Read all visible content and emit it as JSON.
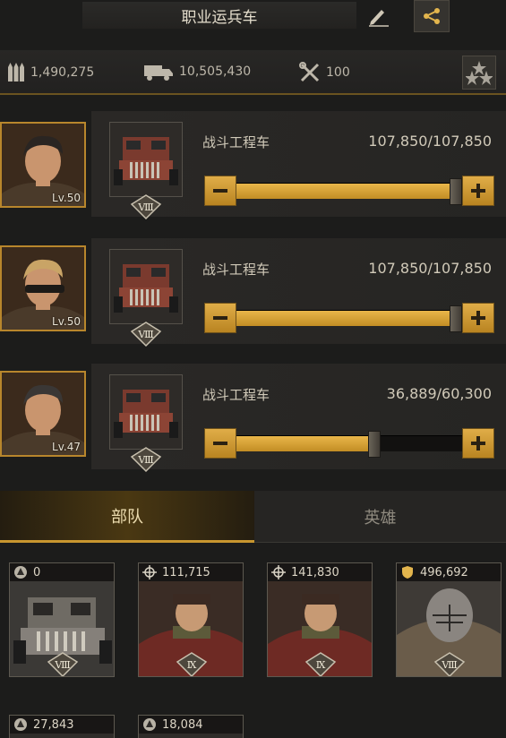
{
  "header": {
    "title": "职业运兵车",
    "edit_icon": "pencil-icon",
    "share_icon": "share-icon"
  },
  "stats": {
    "ammo": "1,490,275",
    "vehicles": "10,505,430",
    "tools": "100"
  },
  "slots": [
    {
      "level": "Lv.50",
      "rank": "Ⅷ",
      "name": "战斗工程车",
      "count": "107,850/107,850",
      "fill_fraction": 1.0
    },
    {
      "level": "Lv.50",
      "rank": "Ⅷ",
      "name": "战斗工程车",
      "count": "107,850/107,850",
      "fill_fraction": 1.0
    },
    {
      "level": "Lv.47",
      "rank": "Ⅷ",
      "name": "战斗工程车",
      "count": "36,889/60,300",
      "fill_fraction": 0.6118
    }
  ],
  "tabs": {
    "troops": "部队",
    "heroes": "英雄"
  },
  "troops": [
    {
      "value": "0",
      "rank": "Ⅷ",
      "icon": "vehicle-type-icon"
    },
    {
      "value": "111,715",
      "rank": "Ⅸ",
      "icon": "crosshair-icon"
    },
    {
      "value": "141,830",
      "rank": "Ⅸ",
      "icon": "crosshair-icon"
    },
    {
      "value": "496,692",
      "rank": "Ⅷ",
      "icon": "shield-icon"
    }
  ],
  "troops_row2": [
    {
      "value": "27,843",
      "icon": "vehicle-type-icon"
    },
    {
      "value": "18,084",
      "icon": "vehicle-type-icon"
    }
  ],
  "colors": {
    "gold": "#c8962f",
    "background": "#1c1c1b",
    "frame_orange": "#b8862c"
  }
}
